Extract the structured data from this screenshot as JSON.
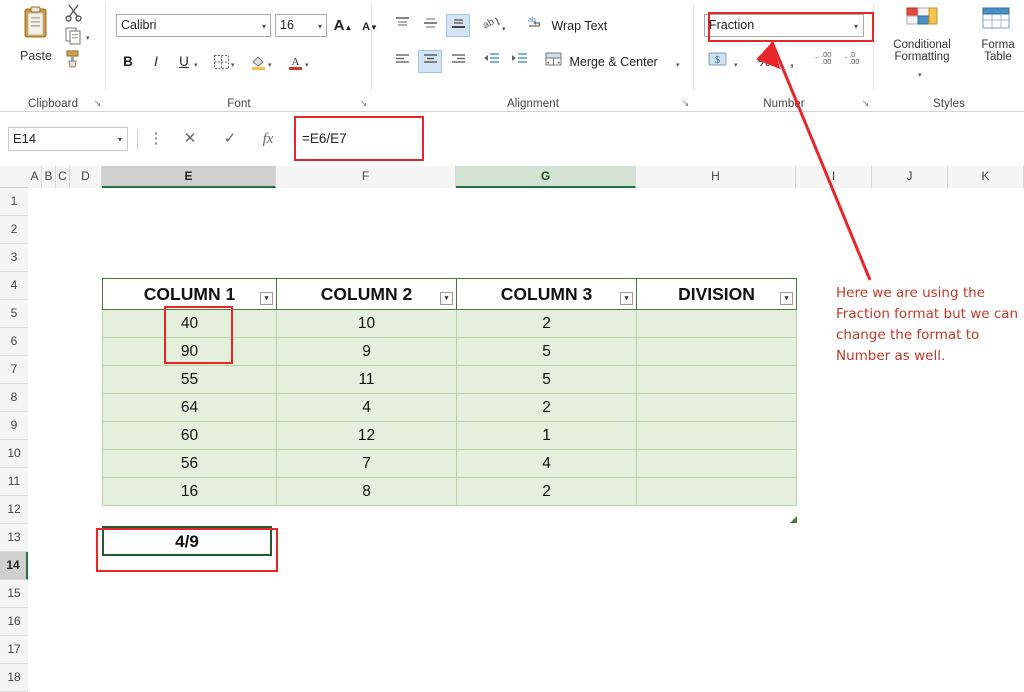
{
  "ribbon": {
    "clipboard": {
      "group_label": "Clipboard",
      "paste_label": "Paste",
      "icons": [
        "clipboard-icon",
        "scissors-icon",
        "copy-icon",
        "format-painter-icon"
      ],
      "launcher": "↘"
    },
    "font": {
      "group_label": "Font",
      "font_name": "Calibri",
      "font_size": "16",
      "grow_font": "A",
      "shrink_font": "A",
      "bold": "B",
      "italic": "I",
      "underline": "U",
      "borders_icon": "borders-icon",
      "fill_color_icon": "fill-color-icon",
      "font_color_icon": "font-color-icon",
      "launcher": "↘"
    },
    "alignment": {
      "group_label": "Alignment",
      "align_top": "align-top-icon",
      "align_middle": "align-middle-icon",
      "align_bottom": "align-bottom-icon",
      "orientation": "orientation-icon",
      "wrap_text": "Wrap Text",
      "wrap_text_icon": "wrap-text-icon",
      "align_left": "align-left-icon",
      "align_center": "align-center-icon",
      "align_right": "align-right-icon",
      "decrease_indent": "decrease-indent-icon",
      "increase_indent": "increase-indent-icon",
      "merge_center": "Merge & Center",
      "launcher": "↘"
    },
    "number": {
      "group_label": "Number",
      "format_value": "Fraction",
      "accounting_icon": "accounting-format-icon",
      "percent_icon": "%",
      "comma_icon": ",",
      "increase_decimal": ".00",
      "decrease_decimal": ".00",
      "launcher": "↘"
    },
    "styles": {
      "group_label": "Styles",
      "conditional_formatting": "Conditional\nFormatting",
      "conditional_formatting_line1": "Conditional",
      "conditional_formatting_line2": "Formatting",
      "format_table_line1": "Forma",
      "format_table_line2": "Table"
    }
  },
  "formula_bar": {
    "name_box": "E14",
    "cancel_icon": "✕",
    "confirm_icon": "✓",
    "function_icon": "fx",
    "formula": "=E6/E7"
  },
  "grid": {
    "column_headers": [
      "A",
      "B",
      "C",
      "D",
      "E",
      "F",
      "G",
      "H",
      "I",
      "J",
      "K"
    ],
    "selected_column": "E",
    "highlighted_column": "G",
    "row_headers": [
      "1",
      "2",
      "3",
      "4",
      "5",
      "6",
      "7",
      "8",
      "9",
      "10",
      "11",
      "12",
      "13",
      "14",
      "15",
      "16",
      "17",
      "18"
    ],
    "selected_row": "14",
    "table": {
      "headers": [
        "COLUMN 1",
        "COLUMN 2",
        "COLUMN 3",
        "DIVISION"
      ],
      "rows": [
        [
          "40",
          "10",
          "2",
          ""
        ],
        [
          "90",
          "9",
          "5",
          ""
        ],
        [
          "55",
          "11",
          "5",
          ""
        ],
        [
          "64",
          "4",
          "2",
          ""
        ],
        [
          "60",
          "12",
          "1",
          ""
        ],
        [
          "56",
          "7",
          "4",
          ""
        ],
        [
          "16",
          "8",
          "2",
          ""
        ]
      ]
    },
    "result_cell": "4/9"
  },
  "annotation": {
    "note": "Here we are using the Fraction format but we can change the format to Number as well.",
    "accent_color": "#e8262a",
    "note_color": "#c0392b"
  }
}
